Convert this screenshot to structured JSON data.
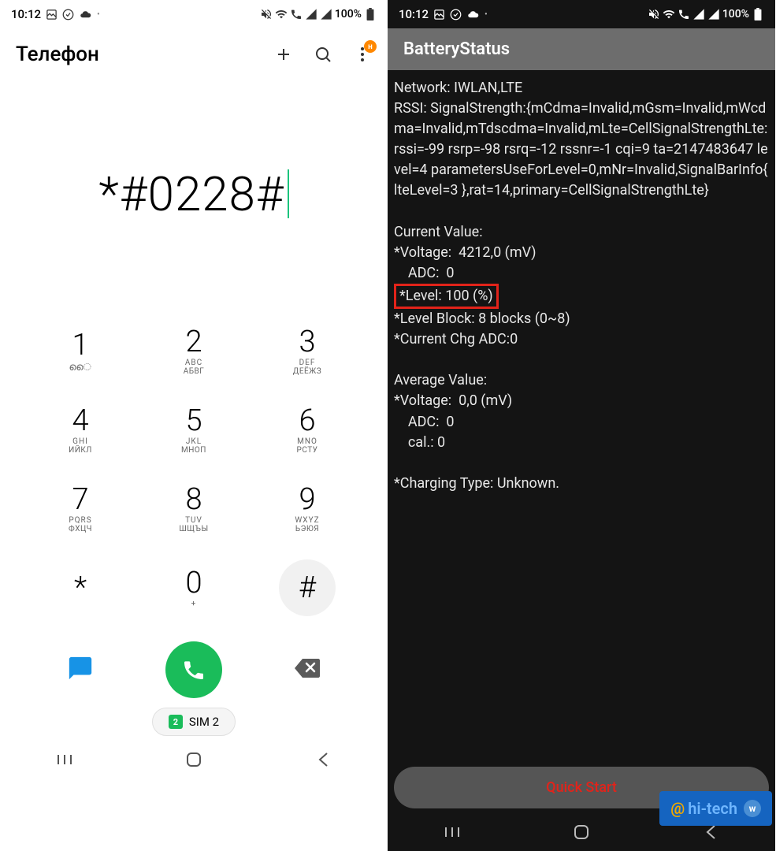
{
  "statusbar": {
    "time": "10:12",
    "battery_pct": "100%"
  },
  "left": {
    "app_title": "Телефон",
    "badge_letter": "н",
    "dialed": "*#0228#",
    "keys": [
      {
        "d": "1",
        "sub1": "",
        "sub2": "ൈ"
      },
      {
        "d": "2",
        "sub1": "ABC",
        "sub2": "АБВГ"
      },
      {
        "d": "3",
        "sub1": "DEF",
        "sub2": "ДЕЁЖЗ"
      },
      {
        "d": "4",
        "sub1": "GHI",
        "sub2": "ИЙКЛ"
      },
      {
        "d": "5",
        "sub1": "JKL",
        "sub2": "МНОП"
      },
      {
        "d": "6",
        "sub1": "MNO",
        "sub2": "РСТУ"
      },
      {
        "d": "7",
        "sub1": "PQRS",
        "sub2": "ФХЦЧ"
      },
      {
        "d": "8",
        "sub1": "TUV",
        "sub2": "ШЩЪЫ"
      },
      {
        "d": "9",
        "sub1": "WXYZ",
        "sub2": "ЬЭЮЯ"
      },
      {
        "d": "*",
        "sub1": "",
        "sub2": ""
      },
      {
        "d": "0",
        "sub1": "+",
        "sub2": ""
      },
      {
        "d": "#",
        "sub1": "",
        "sub2": ""
      }
    ],
    "sim": {
      "num": "2",
      "label": "SIM 2"
    }
  },
  "right": {
    "title": "BatteryStatus",
    "network_line": "Network: IWLAN,LTE",
    "rssi_line": "RSSI: SignalStrength:{mCdma=Invalid,mGsm=Invalid,mWcdma=Invalid,mTdscdma=Invalid,mLte=CellSignalStrengthLte: rssi=-99 rsrp=-98 rsrq=-12 rssnr=-1 cqi=9 ta=2147483647 level=4 parametersUseForLevel=0,mNr=Invalid,SignalBarInfo{ lteLevel=3 },rat=14,primary=CellSignalStrengthLte}",
    "blank1": "",
    "current_header": "Current Value:",
    "voltage": "*Voltage:  4212,0 (mV)",
    "adc": "    ADC:  0",
    "level": "*Level: 100 (%)",
    "level_block": "*Level Block: 8 blocks (0~8)",
    "current_chg": "*Current Chg ADC:0",
    "blank2": "",
    "avg_header": "Average Value:",
    "avg_voltage": "*Voltage:  0,0 (mV)",
    "avg_adc": "    ADC:  0",
    "avg_cal": "    cal.: 0",
    "blank3": "",
    "charging": "*Charging Type: Unknown.",
    "quick_start": "Quick Start"
  },
  "watermark": {
    "at": "@",
    "text": "hi-tech",
    "vk": "w"
  }
}
